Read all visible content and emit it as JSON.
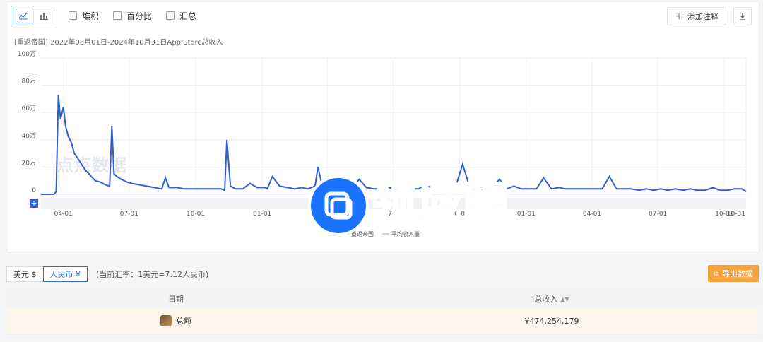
{
  "toolbar": {
    "stack_label": "堆积",
    "percent_label": "百分比",
    "summary_label": "汇总",
    "add_note_label": "添加注释"
  },
  "chart_data": {
    "type": "line",
    "subtitle": "[重返帝国] 2022年03月01日-2024年10月31日App Store总收入",
    "y_ticks": [
      "100万",
      "80万",
      "60万",
      "40万",
      "20万",
      "0"
    ],
    "ylim": [
      0,
      1000000
    ],
    "x_ticks": [
      "04-01",
      "07-01",
      "10-01",
      "01-01",
      "04-01",
      "07-01",
      "10-01",
      "01-01",
      "04-01",
      "07-01",
      "10-01",
      "10-31"
    ],
    "x_start": "2022-03-01",
    "x_end": "2024-10-31",
    "grid": true,
    "legend_position": "bottom-center",
    "series": [
      {
        "name": "重返帝国",
        "color": "#2f5fd6",
        "x": [
          "2022-03-01",
          "2022-03-15",
          "2022-03-19",
          "2022-03-22",
          "2022-03-25",
          "2022-03-28",
          "2022-04-01",
          "2022-04-04",
          "2022-04-08",
          "2022-04-12",
          "2022-04-16",
          "2022-04-20",
          "2022-04-25",
          "2022-05-01",
          "2022-05-08",
          "2022-05-15",
          "2022-05-22",
          "2022-05-29",
          "2022-06-04",
          "2022-06-07",
          "2022-06-10",
          "2022-06-14",
          "2022-06-20",
          "2022-06-28",
          "2022-07-05",
          "2022-07-15",
          "2022-07-25",
          "2022-08-05",
          "2022-08-15",
          "2022-08-20",
          "2022-08-25",
          "2022-09-05",
          "2022-09-15",
          "2022-09-25",
          "2022-10-05",
          "2022-10-15",
          "2022-10-25",
          "2022-11-05",
          "2022-11-10",
          "2022-11-13",
          "2022-11-18",
          "2022-11-25",
          "2022-12-05",
          "2022-12-15",
          "2022-12-25",
          "2023-01-05",
          "2023-01-08",
          "2023-01-15",
          "2023-01-25",
          "2023-02-05",
          "2023-02-15",
          "2023-02-25",
          "2023-03-05",
          "2023-03-15",
          "2023-03-19",
          "2023-03-25",
          "2023-04-05",
          "2023-04-15",
          "2023-04-25",
          "2023-05-05",
          "2023-05-15",
          "2023-05-25",
          "2023-06-05",
          "2023-06-15",
          "2023-06-25",
          "2023-07-05",
          "2023-07-15",
          "2023-07-25",
          "2023-08-05",
          "2023-08-15",
          "2023-08-25",
          "2023-09-05",
          "2023-09-15",
          "2023-09-25",
          "2023-10-05",
          "2023-10-15",
          "2023-10-25",
          "2023-11-05",
          "2023-11-15",
          "2023-11-25",
          "2023-12-05",
          "2023-12-15",
          "2023-12-25",
          "2024-01-05",
          "2024-01-15",
          "2024-01-25",
          "2024-02-05",
          "2024-02-15",
          "2024-02-25",
          "2024-03-05",
          "2024-03-15",
          "2024-03-25",
          "2024-04-05",
          "2024-04-15",
          "2024-04-25",
          "2024-05-05",
          "2024-05-15",
          "2024-05-25",
          "2024-06-05",
          "2024-06-15",
          "2024-06-25",
          "2024-07-05",
          "2024-07-15",
          "2024-07-25",
          "2024-08-05",
          "2024-08-15",
          "2024-08-25",
          "2024-09-05",
          "2024-09-15",
          "2024-09-25",
          "2024-10-05",
          "2024-10-15",
          "2024-10-25",
          "2024-10-31"
        ],
        "values": [
          0,
          0,
          0,
          20000,
          730000,
          550000,
          640000,
          500000,
          420000,
          380000,
          300000,
          270000,
          230000,
          180000,
          140000,
          100000,
          90000,
          70000,
          60000,
          500000,
          150000,
          130000,
          110000,
          90000,
          80000,
          70000,
          60000,
          50000,
          40000,
          120000,
          50000,
          50000,
          40000,
          40000,
          40000,
          40000,
          40000,
          40000,
          30000,
          400000,
          60000,
          40000,
          40000,
          80000,
          50000,
          50000,
          40000,
          130000,
          60000,
          50000,
          40000,
          50000,
          40000,
          60000,
          200000,
          60000,
          50000,
          40000,
          50000,
          40000,
          110000,
          50000,
          40000,
          40000,
          50000,
          40000,
          50000,
          40000,
          40000,
          70000,
          40000,
          40000,
          40000,
          50000,
          220000,
          50000,
          40000,
          40000,
          50000,
          110000,
          40000,
          60000,
          40000,
          40000,
          40000,
          120000,
          40000,
          50000,
          40000,
          40000,
          40000,
          40000,
          40000,
          40000,
          130000,
          40000,
          40000,
          40000,
          30000,
          40000,
          30000,
          40000,
          30000,
          40000,
          30000,
          40000,
          30000,
          30000,
          50000,
          30000,
          30000,
          40000,
          40000,
          20000
        ]
      },
      {
        "name": "平均收入量",
        "color": "#cfd3da",
        "x": [],
        "values": []
      }
    ]
  },
  "currency": {
    "usd_label": "美元 $",
    "cny_label": "人民币 ¥",
    "rate_note": "(当前汇率：1美元=7.12人民币)",
    "export_label": "导出数据"
  },
  "table": {
    "col_date": "日期",
    "col_revenue": "总收入",
    "rows": [
      {
        "date": "总额",
        "revenue": "¥474,254,179"
      }
    ]
  },
  "watermark": {
    "faint_text": "点点数据",
    "text": "领域圈"
  }
}
